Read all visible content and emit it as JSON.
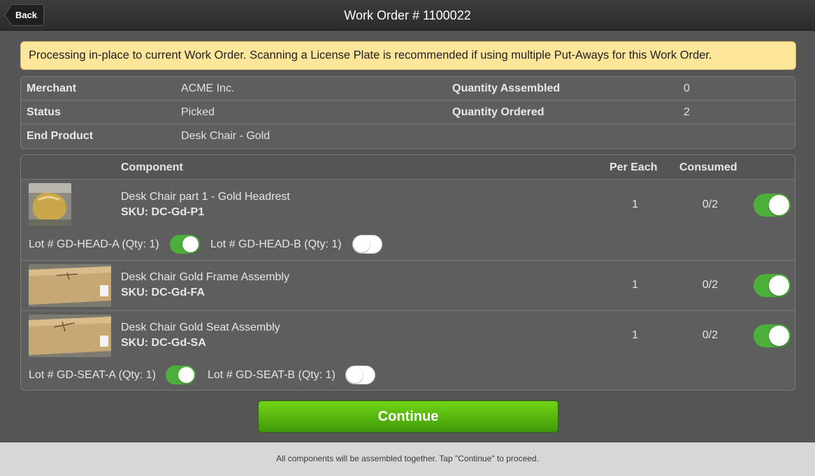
{
  "header": {
    "back_label": "Back",
    "title": "Work Order # 1100022"
  },
  "notice": {
    "text": "Processing in-place to current Work Order. Scanning a License Plate is recommended if using multiple Put-Aways for this Work Order."
  },
  "info": {
    "merchant_label": "Merchant",
    "merchant_value": "ACME Inc.",
    "status_label": "Status",
    "status_value": "Picked",
    "end_product_label": "End Product",
    "end_product_value": "Desk Chair - Gold",
    "qty_assembled_label": "Quantity Assembled",
    "qty_assembled_value": "0",
    "qty_ordered_label": "Quantity Ordered",
    "qty_ordered_value": "2"
  },
  "components": {
    "headers": {
      "component": "Component",
      "per_each": "Per Each",
      "consumed": "Consumed"
    },
    "rows": [
      {
        "name": "Desk Chair part 1 - Gold Headrest",
        "sku": "SKU: DC-Gd-P1",
        "per_each": "1",
        "consumed": "0/2",
        "toggle_on": true,
        "lots": [
          {
            "label": "Lot # GD-HEAD-A (Qty: 1)",
            "on": true
          },
          {
            "label": "Lot # GD-HEAD-B (Qty: 1)",
            "on": false
          }
        ]
      },
      {
        "name": "Desk Chair Gold Frame Assembly",
        "sku": "SKU: DC-Gd-FA",
        "per_each": "1",
        "consumed": "0/2",
        "toggle_on": true
      },
      {
        "name": "Desk Chair Gold Seat Assembly",
        "sku": "SKU: DC-Gd-SA",
        "per_each": "1",
        "consumed": "0/2",
        "toggle_on": true,
        "lots": [
          {
            "label": "Lot # GD-SEAT-A (Qty: 1)",
            "on": true
          },
          {
            "label": "Lot # GD-SEAT-B (Qty: 1)",
            "on": false
          }
        ]
      }
    ]
  },
  "continue_label": "Continue",
  "footer_text": "All components will be assembled together. Tap \"Continue\" to proceed.",
  "colors": {
    "toggle_on": "#4caf3a",
    "notice_bg": "#fde59a",
    "continue_green": "#5cbb0e"
  }
}
